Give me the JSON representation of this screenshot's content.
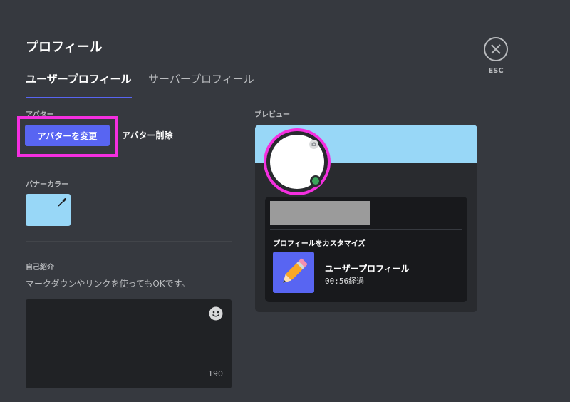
{
  "header": {
    "title": "プロフィール",
    "close_label": "ESC"
  },
  "tabs": [
    {
      "label": "ユーザープロフィール",
      "active": true
    },
    {
      "label": "サーバープロフィール",
      "active": false
    }
  ],
  "avatar_section": {
    "label": "アバター",
    "change_button": "アバターを変更",
    "delete_button": "アバター削除"
  },
  "banner_section": {
    "label": "バナーカラー",
    "color": "#98d7f7"
  },
  "bio_section": {
    "label": "自己紹介",
    "hint": "マークダウンやリンクを使ってもOKです。",
    "value": "",
    "remaining": "190"
  },
  "preview": {
    "label": "プレビュー",
    "activity_title": "プロフィールをカスタマイズ",
    "app_name": "ユーザープロフィール",
    "elapsed": "00:56経過"
  },
  "colors": {
    "background": "#36393f",
    "accent": "#5865f2",
    "highlight": "#f52fe0",
    "online": "#3ba55c"
  }
}
